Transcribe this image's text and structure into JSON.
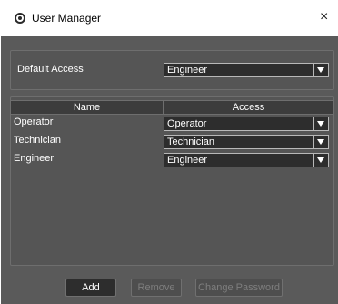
{
  "window": {
    "title": "User Manager",
    "close_glyph": "×",
    "app_icon": "radio-target-icon"
  },
  "default_access": {
    "label": "Default Access",
    "value": "Engineer"
  },
  "table": {
    "headers": [
      "Name",
      "Access"
    ],
    "rows": [
      {
        "name": "Operator",
        "access": "Operator"
      },
      {
        "name": "Technician",
        "access": "Technician"
      },
      {
        "name": "Engineer",
        "access": "Engineer"
      }
    ]
  },
  "buttons": {
    "add": "Add",
    "remove": "Remove",
    "change_password": "Change Password"
  },
  "colors": {
    "panel_bg": "#5a5a5a",
    "field_bg": "#2d2d2d",
    "text": "#ffffff"
  }
}
